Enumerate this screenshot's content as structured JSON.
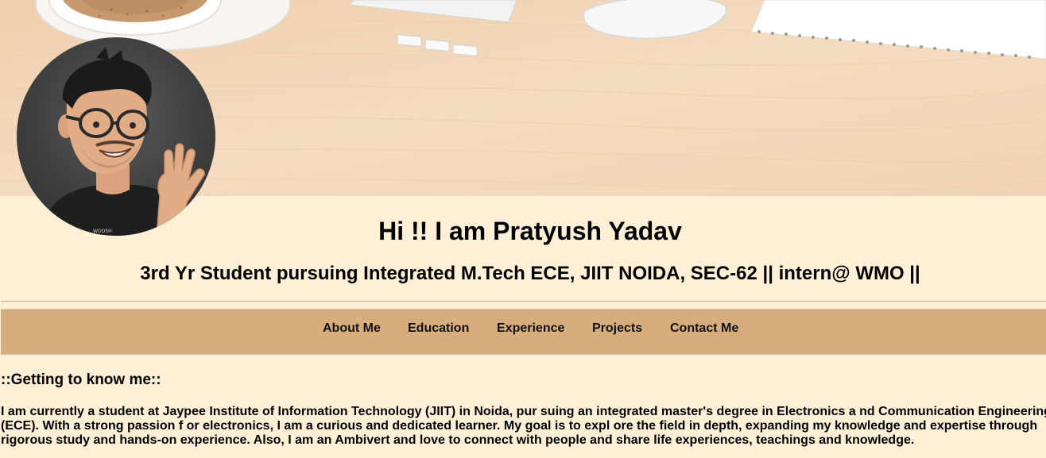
{
  "header": {
    "title": "Hi !! I am Pratyush Yadav",
    "subtitle": "3rd Yr Student pursuing Integrated M.Tech ECE, JIIT NOIDA, SEC-62 || intern@ WMO ||"
  },
  "nav": {
    "items": [
      {
        "label": "About Me"
      },
      {
        "label": "Education"
      },
      {
        "label": "Experience"
      },
      {
        "label": "Projects"
      },
      {
        "label": "Contact Me"
      }
    ]
  },
  "about": {
    "heading": "::Getting to know me::",
    "lines": [
      "I am currently a student at Jaypee Institute of Information Technology (JIIT) in Noida, pur suing an integrated master's degree in Electronics a nd Communication Engineering",
      "(ECE). With a strong passion f or electronics, I am a curious and dedicated learner. My goal is to expl ore the field in depth, expanding my knowledge and expertise through",
      "rigorous study and hands-on experience. Also, I am an Ambivert and love to connect with people and share life experiences, teachings and knowledge."
    ]
  },
  "avatar_shirt_text": "WOOSH",
  "colors": {
    "page_background": "#fdf0d6",
    "nav_background": "#d8ad7c",
    "banner_wood": "#f3dbbf"
  },
  "icons": {
    "avatar": "bitmoji-avatar-waving",
    "banner": "desk-workspace-photo"
  }
}
